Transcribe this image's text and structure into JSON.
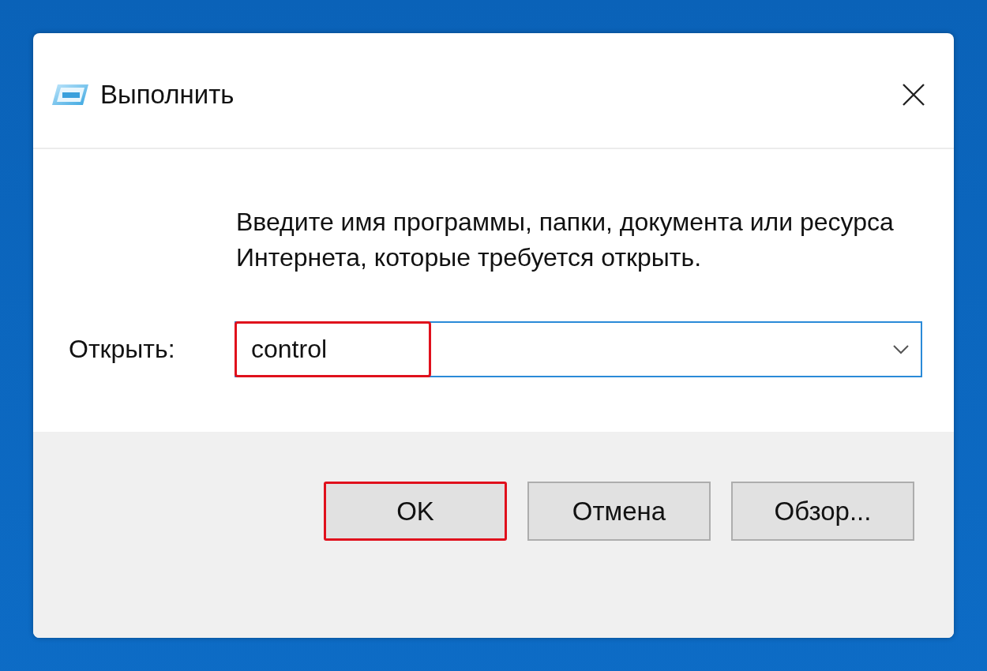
{
  "window": {
    "title": "Выполнить"
  },
  "prompt": "Введите имя программы, папки, документа или ресурса Интернета, которые требуется открыть.",
  "open_field": {
    "label": "Открыть:",
    "value": "control",
    "highlighted": true
  },
  "buttons": [
    {
      "label": "OK",
      "highlighted": true
    },
    {
      "label": "Отмена",
      "highlighted": false
    },
    {
      "label": "Обзор...",
      "highlighted": false
    }
  ]
}
